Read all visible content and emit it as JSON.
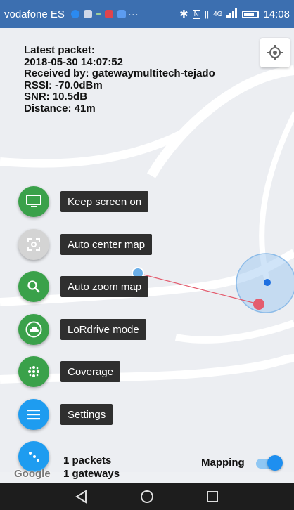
{
  "status_bar": {
    "carrier": "vodafone ES",
    "network": "4G",
    "time": "14:08"
  },
  "info": {
    "title": "Latest packet:",
    "timestamp": "2018-05-30 14:07:52",
    "received_by": "Received by: gatewaymultitech-tejado",
    "rssi": "RSSI: -70.0dBm",
    "snr": "SNR: 10.5dB",
    "distance": "Distance: 41m"
  },
  "menu": {
    "keep_screen_on": "Keep screen on",
    "auto_center_map": "Auto center map",
    "auto_zoom_map": "Auto zoom map",
    "lordrive_mode": "LoRdrive mode",
    "coverage": "Coverage",
    "settings": "Settings"
  },
  "counts": {
    "packets": "1 packets",
    "gateways": "1 gateways"
  },
  "mapping": {
    "label": "Mapping",
    "enabled": true
  },
  "attribution": "Google",
  "colors": {
    "green": "#3aa14a",
    "blue": "#1e9cf0",
    "grey": "#d4d4d4",
    "status_bar": "#3c6fb0",
    "packet_point": "#e45c6e"
  }
}
